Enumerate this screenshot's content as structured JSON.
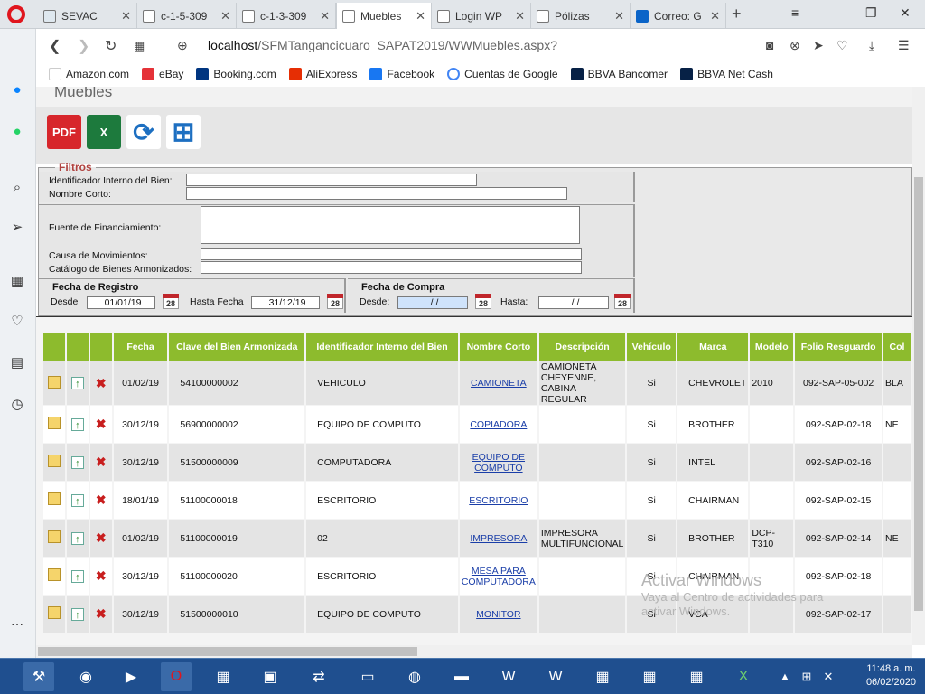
{
  "tabs": [
    {
      "label": "SEVAC"
    },
    {
      "label": "c-1-5-309"
    },
    {
      "label": "c-1-3-309"
    },
    {
      "label": "Muebles"
    },
    {
      "label": "Login WP"
    },
    {
      "label": "Pólizas"
    },
    {
      "label": "Correo: G"
    }
  ],
  "address": {
    "host": "localhost",
    "path": "/SFMTangancicuaro_SAPAT2019/WWMuebles.aspx?"
  },
  "bookmarks": [
    {
      "label": "Amazon.com",
      "color": "#222222"
    },
    {
      "label": "eBay",
      "color": "#e53238"
    },
    {
      "label": "Booking.com",
      "color": "#003580"
    },
    {
      "label": "AliExpress",
      "color": "#e62e04"
    },
    {
      "label": "Facebook",
      "color": "#1877f2"
    },
    {
      "label": "Cuentas de Google",
      "color": "#4285f4"
    },
    {
      "label": "BBVA Bancomer",
      "color": "#072146"
    },
    {
      "label": "BBVA Net Cash",
      "color": "#072146"
    }
  ],
  "page": {
    "title": "Muebles",
    "toolbar": {
      "pdf": "PDF",
      "xls": "X"
    },
    "filters": {
      "legend": "Filtros",
      "id_label": "Identificador Interno del Bien:",
      "nombre_label": "Nombre Corto:",
      "fuente_label": "Fuente de Financiamiento:",
      "causa_label": "Causa de Movimientos:",
      "catalogo_label": "Catálogo de Bienes Armonizados:",
      "registro_title": "Fecha de Registro",
      "desde_label": "Desde",
      "desde_value": "01/01/19",
      "hasta_label": "Hasta Fecha",
      "hasta_value": "31/12/19",
      "compra_title": "Fecha de Compra",
      "compra_desde_label": "Desde:",
      "compra_desde_value": "/ /",
      "compra_hasta_label": "Hasta:",
      "compra_hasta_value": "/ /",
      "cal_label": "28"
    },
    "grid": {
      "headers": [
        "",
        "",
        "",
        "Fecha",
        "Clave del Bien Armonizada",
        "Identificador Interno del Bien",
        "Nombre Corto",
        "Descripción",
        "Vehículo",
        "Marca",
        "Modelo",
        "Folio Resguardo",
        "Col"
      ],
      "rows": [
        {
          "fecha": "01/02/19",
          "clave": "54100000002",
          "ident": "VEHICULO",
          "nombre": "CAMIONETA",
          "desc": "CAMIONETA CHEYENNE, CABINA REGULAR",
          "veh": "Si",
          "marca": "CHEVROLET",
          "modelo": "2010",
          "folio": "092-SAP-05-002",
          "col": "BLA"
        },
        {
          "fecha": "30/12/19",
          "clave": "56900000002",
          "ident": "EQUIPO DE COMPUTO",
          "nombre": "COPIADORA",
          "desc": "",
          "veh": "Si",
          "marca": "BROTHER",
          "modelo": "",
          "folio": "092-SAP-02-18",
          "col": "NE"
        },
        {
          "fecha": "30/12/19",
          "clave": "51500000009",
          "ident": "COMPUTADORA",
          "nombre": "EQUIPO DE COMPUTO",
          "desc": "",
          "veh": "Si",
          "marca": "INTEL",
          "modelo": "",
          "folio": "092-SAP-02-16",
          "col": ""
        },
        {
          "fecha": "18/01/19",
          "clave": "51100000018",
          "ident": "ESCRITORIO",
          "nombre": "ESCRITORIO",
          "desc": "",
          "veh": "Si",
          "marca": "CHAIRMAN",
          "modelo": "",
          "folio": "092-SAP-02-15",
          "col": ""
        },
        {
          "fecha": "01/02/19",
          "clave": "51100000019",
          "ident": "02",
          "nombre": "IMPRESORA",
          "desc": "IMPRESORA MULTIFUNCIONAL",
          "veh": "Si",
          "marca": "BROTHER",
          "modelo": "DCP-T310",
          "folio": "092-SAP-02-14",
          "col": "NE"
        },
        {
          "fecha": "30/12/19",
          "clave": "51100000020",
          "ident": "ESCRITORIO",
          "nombre": "MESA PARA COMPUTADORA",
          "desc": "",
          "veh": "Si",
          "marca": "CHAIRMAN",
          "modelo": "",
          "folio": "092-SAP-02-18",
          "col": ""
        },
        {
          "fecha": "30/12/19",
          "clave": "51500000010",
          "ident": "EQUIPO DE COMPUTO",
          "nombre": "MONITOR",
          "desc": "",
          "veh": "Si",
          "marca": "VCA",
          "modelo": "",
          "folio": "092-SAP-02-17",
          "col": ""
        }
      ]
    }
  },
  "watermark": {
    "line1": "Activar Windows",
    "line2": "Vaya al Centro de actividades para",
    "line3": "activar Windows."
  },
  "clock": {
    "time": "11:48 a. m.",
    "date": "06/02/2020"
  }
}
